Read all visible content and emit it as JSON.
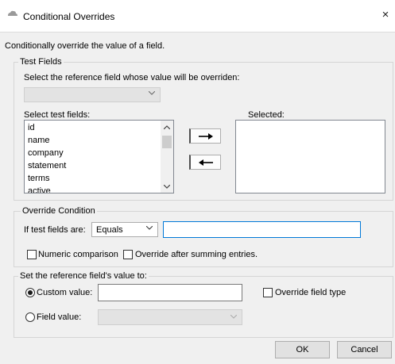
{
  "window": {
    "title": "Conditional Overrides",
    "close_glyph": "×",
    "icon": "cloud-icon"
  },
  "description": "Conditionally override the value of a field.",
  "test_fields": {
    "legend": "Test Fields",
    "reference_label": "Select the reference field whose value will be overriden:",
    "reference_value": "",
    "select_label": "Select test fields:",
    "selected_label": "Selected:",
    "fields": [
      "id",
      "name",
      "company",
      "statement",
      "terms",
      "active"
    ],
    "selected": [],
    "add_glyph": "⟶",
    "remove_glyph": "⟵"
  },
  "override_condition": {
    "legend": "Override Condition",
    "if_label": "If test fields are:",
    "operator": "Equals",
    "value": "",
    "numeric_label": "Numeric comparison",
    "numeric_checked": false,
    "summing_label": "Override after summing entries.",
    "summing_checked": false
  },
  "set_value": {
    "legend": "Set the reference field's value to:",
    "custom_label": "Custom value:",
    "custom_selected": true,
    "custom_value": "",
    "override_type_label": "Override field type",
    "override_type_checked": false,
    "field_label": "Field value:",
    "field_selected": false,
    "field_value": ""
  },
  "buttons": {
    "ok": "OK",
    "cancel": "Cancel"
  }
}
